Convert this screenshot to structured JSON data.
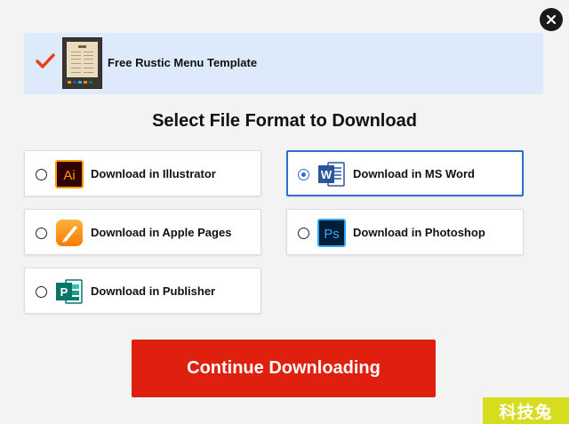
{
  "dialog": {
    "close_icon": "close-icon",
    "banner": {
      "check_icon": "checkmark-icon",
      "template_name": "Free Rustic Menu Template"
    },
    "heading": "Select File Format to Download",
    "options": [
      {
        "label": "Download in Illustrator",
        "icon": "illustrator-icon",
        "icon_text": "Ai",
        "selected": false,
        "color": "#ff9a00"
      },
      {
        "label": "Download in MS Word",
        "icon": "word-icon",
        "icon_text": "W",
        "selected": true,
        "color": "#2b579a"
      },
      {
        "label": "Download in Apple Pages",
        "icon": "pages-icon",
        "icon_text": "",
        "selected": false,
        "color": "#f58a07"
      },
      {
        "label": "Download in Photoshop",
        "icon": "photoshop-icon",
        "icon_text": "Ps",
        "selected": false,
        "color": "#31a8ff"
      },
      {
        "label": "Download in Publisher",
        "icon": "publisher-icon",
        "icon_text": "P",
        "selected": false,
        "color": "#077568"
      }
    ],
    "continue_label": "Continue Downloading",
    "accent_color": "#e0200f"
  },
  "watermark": "科技兔"
}
